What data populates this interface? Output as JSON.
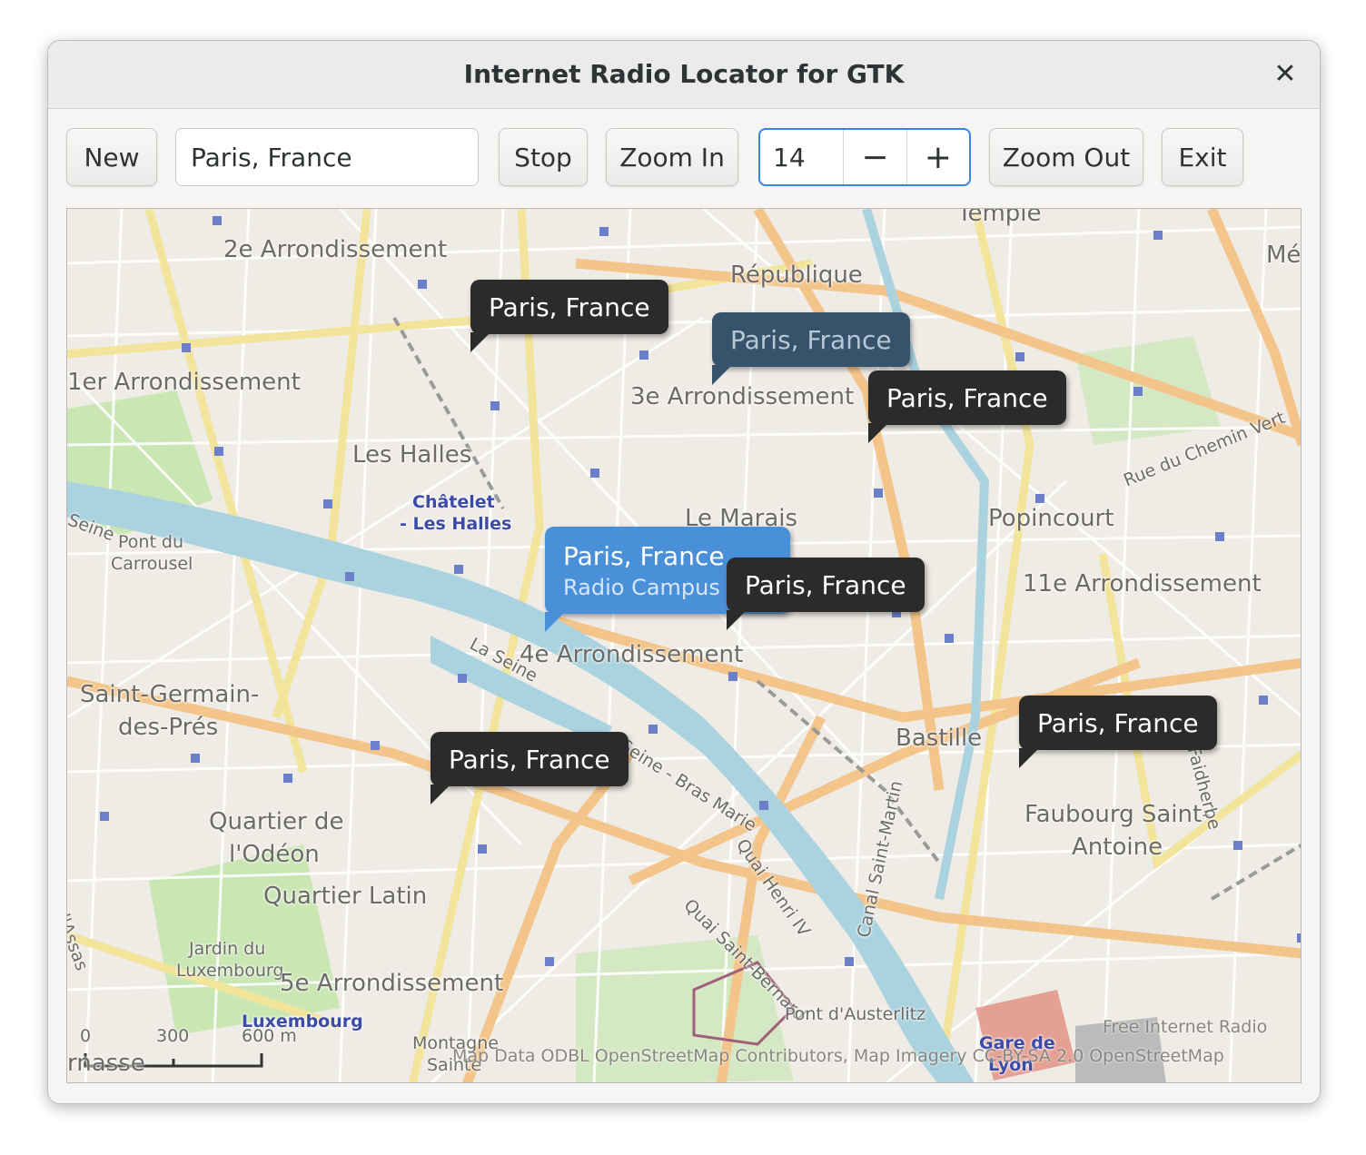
{
  "window": {
    "title": "Internet Radio Locator for GTK",
    "close_icon": "close-icon"
  },
  "toolbar": {
    "new_label": "New",
    "location_value": "Paris, France",
    "stop_label": "Stop",
    "zoom_in_label": "Zoom In",
    "zoom_value": "14",
    "decrement_glyph": "−",
    "increment_glyph": "+",
    "zoom_out_label": "Zoom Out",
    "exit_label": "Exit"
  },
  "map": {
    "markers": [
      {
        "label": "Paris, France"
      },
      {
        "label": "Paris, France"
      },
      {
        "label": "Paris, France"
      },
      {
        "label": "Paris, France",
        "sublabel": "Radio Campus F"
      },
      {
        "label": "Paris, France"
      },
      {
        "label": "Paris, France"
      },
      {
        "label": "Paris, France"
      }
    ],
    "labels": {
      "temple": "Temple",
      "arr2": "2e Arrondissement",
      "republique": "République",
      "arr1": "1er Arrondissement",
      "arr3": "3e Arrondissement",
      "halles": "Les Halles",
      "chatelet": "Châtelet",
      "chatelet2": "- Les Halles",
      "marais": "Le Marais",
      "popincourt": "Popincourt",
      "chemin_vert": "Rue du Chemin Vert",
      "arr11": "11e Arrondissement",
      "pont_carrousel": "Pont du",
      "pont_carrousel2": "Carrousel",
      "seine_left": "Seine",
      "arr4": "4e Arrondissement",
      "la_seine": "La Seine",
      "stgermain": "Saint-Germain-",
      "stgermain2": "des-Prés",
      "bastille": "Bastille",
      "seine_bras": "Seine - Bras Marie",
      "faubourg": "Faubourg Saint-",
      "faubourg2": "Antoine",
      "odeon": "Quartier de",
      "odeon2": "l'Odéon",
      "latin": "Quartier Latin",
      "quai_henri": "Quai Henri IV",
      "quai_bernard": "Quai Saint-Bernard",
      "canal": "Canal Saint-Martin",
      "jardin": "Jardin du",
      "jardin2": "Luxembourg",
      "arr5": "5e Arrondissement",
      "luxembourg": "Luxembourg",
      "montagne": "Montagne",
      "montagne2": "Sainte",
      "austerlitz": "Pont d'Austerlitz",
      "gare": "Gare de",
      "gare2": "Lyon",
      "assas": "rd'Assas",
      "masse": "rnasse",
      "faidherbe": "Faidherbe",
      "me": "Mé"
    },
    "scale": {
      "s0": "0",
      "s300": "300",
      "s600": "600 m"
    },
    "attribution_1": "Free Internet Radio",
    "attribution_2": "Map Data ODBL OpenStreetMap Contributors, Map Imagery CC-BY-SA 2.0 OpenStreetMap"
  }
}
